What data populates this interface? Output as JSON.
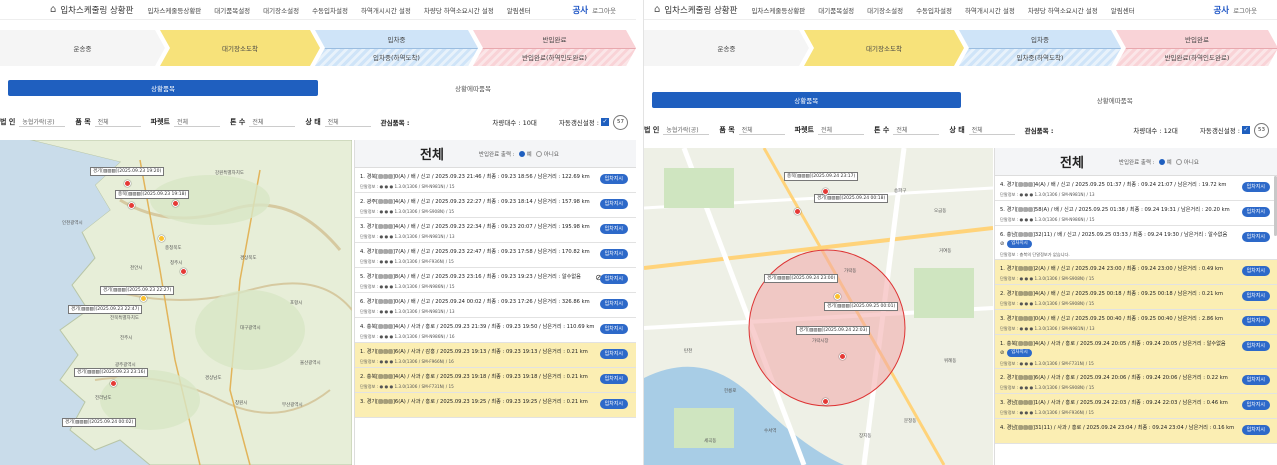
{
  "panels": [
    {
      "nav": {
        "title": "입차스케줄링 상황판",
        "menu": [
          "입차스케줄등상황판",
          "대기품목설정",
          "대기장소설정",
          "수동입차설정",
          "하역개시시간 설정",
          "차량당 하역소요시간 설정",
          "알림센터"
        ],
        "user": "공사",
        "logout": "로그아웃"
      },
      "steps": {
        "moving": "운송중",
        "waiting": "대기장소도착",
        "loading": "입차중",
        "loading_sub": "입차중(하역도착)",
        "unloading": "반입완료",
        "unloading_sub": "반입완료(하역인도완료)"
      },
      "tabs": {
        "active": "상황품목",
        "inactive": "상황에따품목"
      },
      "filters": {
        "corp_label": "법 인",
        "corp_value": "농협가락(공)",
        "item_label": "품 목",
        "item_value": "전체",
        "pallet_label": "파렛트",
        "pallet_value": "전체",
        "ton_label": "톤 수",
        "ton_value": "전체",
        "state_label": "상 태",
        "state_value": "전체",
        "interest": "관심품목 :",
        "count": "차량대수 : 10대",
        "auto": "자동갱신설정 :",
        "timer": "57"
      },
      "map_labels": [
        "경기[▨▨▨](2025.09.23 19:20)",
        "충북[▨▨▨](2025.09.23 19:18)",
        "경기[▨▨▨](2025.09.23 22:27)",
        "경기[▨▨▨](2025.09.23 22:47)",
        "경기[▨▨▨](2025.09.23 23:16)",
        "경기[▨▨▨](2025.09.24 00:02)"
      ],
      "map_places": [
        "강원특별자치도",
        "충청북도",
        "경상북도",
        "전북특별자치도",
        "전라남도",
        "경상남도",
        "대전광역시",
        "대구광역시",
        "광주광역시",
        "부산광역시",
        "인천광역시",
        "천안시",
        "청주시",
        "포항시",
        "울산광역시",
        "전주시",
        "창원시"
      ],
      "list_title": "전체",
      "list_option": "반입완료 출력 :",
      "opt_yes": "예",
      "opt_no": "아니요",
      "btn": "입차지시",
      "rows": [
        {
          "main": "1. 경북[▨▨▨]0(A) / 배 / 신고 / 2025.09.23 21:46 / 최종 : 09.23 18:56 / 남은거리 : 122.69 km",
          "sub": "단말정보 : ● ● ● 1.3.0(1306 / SM-N981N) / 15",
          "y": false,
          "ban": false
        },
        {
          "main": "2. 광주[▨▨▨]4(A) / 배 / 신고 / 2025.09.23 22:27 / 최종 : 09.23 18:14 / 남은거리 : 157.98 km",
          "sub": "단말정보 : ● ● ● 1.3.0(1306 / SM-S908N) / 15",
          "y": false,
          "ban": false
        },
        {
          "main": "3. 경기[▨▨▨]4(A) / 배 / 신고 / 2025.09.23 22:34 / 최종 : 09.23 20:07 / 남은거리 : 195.98 km",
          "sub": "단말정보 : ● ● ● 1.3.0(1306 / SM-N981N) / 13",
          "y": false,
          "ban": false
        },
        {
          "main": "4. 경기[▨▨▨]7(A) / 배 / 신고 / 2025.09.23 22:47 / 최종 : 09.23 17:58 / 남은거리 : 170.82 km",
          "sub": "단말정보 : ● ● ● 1.3.0(1306 / SM-F936N) / 15",
          "y": false,
          "ban": false
        },
        {
          "main": "5. 경기[▨▨▨]8(A) / 배 / 신고 / 2025.09.23 23:16 / 최종 : 09.23 19:23 / 남은거리 : 알수없음",
          "sub": "단말정보 : ● ● ● 1.3.0(1306 / SM-N986N) / 15",
          "y": false,
          "ban": true
        },
        {
          "main": "6. 경기[▨▨▨]0(A) / 배 / 신고 / 2025.09.24 00:02 / 최종 : 09.23 17:26 / 남은거리 : 326.86 km",
          "sub": "단말정보 : ● ● ● 1.3.0(1306 / SM-N981N) / 13",
          "y": false,
          "ban": false
        },
        {
          "main": "4. 충북[▨▨▨]4(A) / 사과 / 홍로 / 2025.09.23 21:39 / 최종 : 09.23 19:50 / 남은거리 : 110.69 km",
          "sub": "단말정보 : ● ● ● 1.3.0(1306 / SM-N986N) / 16",
          "y": false,
          "ban": false
        },
        {
          "main": "1. 경기[▨▨▨]6(A) / 사과 / 감홍 / 2025.09.23 19:13 / 최종 : 09.23 19:13 / 남은거리 : 0.21 km",
          "sub": "단말정보 : ● ● ● 1.3.0(1306 / SM-F966N) / 16",
          "y": true,
          "ban": false
        },
        {
          "main": "2. 충북[▨▨▨]4(A) / 사과 / 홍로 / 2025.09.23 19:18 / 최종 : 09.23 19:18 / 남은거리 : 0.21 km",
          "sub": "단말정보 : ● ● ● 1.3.0(1306 / SM-F731N) / 15",
          "y": true,
          "ban": false
        },
        {
          "main": "3. 경기[▨▨▨]6(A) / 사과 / 홍로 / 2025.09.23 19:25 / 최종 : 09.23 19:25 / 남은거리 : 0.21 km",
          "sub": "",
          "y": true,
          "ban": false
        }
      ]
    },
    {
      "nav": {
        "title": "입차스케줄링 상황판",
        "menu": [
          "입차스케줄등상황판",
          "대기품목설정",
          "대기장소설정",
          "수동입차설정",
          "하역개시시간 설정",
          "차량당 하역소요시간 설정",
          "알림센터"
        ],
        "user": "공사",
        "logout": "로그아웃"
      },
      "steps": {
        "moving": "운송중",
        "waiting": "대기장소도착",
        "loading": "입차중",
        "loading_sub": "입차중(하역도착)",
        "unloading": "반입완료",
        "unloading_sub": "반입완료(하역인도완료)"
      },
      "tabs": {
        "active": "상황품목",
        "inactive": "상황에따품목"
      },
      "filters": {
        "corp_label": "법 인",
        "corp_value": "농협가락(공)",
        "item_label": "품 목",
        "item_value": "전체",
        "pallet_label": "파렛트",
        "pallet_value": "전체",
        "ton_label": "톤 수",
        "ton_value": "전체",
        "state_label": "상 태",
        "state_value": "전체",
        "interest": "관심품목 :",
        "count": "차량대수 : 12대",
        "auto": "자동갱신설정 :",
        "timer": "53"
      },
      "map_labels": [
        "충북[▨▨▨](2025.09.24 23:17)",
        "경기[▨▨▨](2025.09.24 00:18)",
        "경기[▨▨▨](2025.09.25 00:01)",
        "경기[▨▨▨](2025.09.24 23:00)",
        "경기[▨▨▨](2025.09.24 22:03)"
      ],
      "map_places": [
        "가락시장",
        "문정동",
        "송파구",
        "장지동",
        "위례동",
        "거여동",
        "탄천",
        "세곡동",
        "수서역",
        "가락동",
        "오금동",
        "헌릉로"
      ],
      "list_title": "전체",
      "list_option": "반입완료 출력 :",
      "opt_yes": "예",
      "opt_no": "아니요",
      "btn": "입차지시",
      "rows": [
        {
          "main": "4. 경기[▨▨▨]4(A) / 배 / 신고 / 2025.09.25 01:37 / 최종 : 09.24 21:07 / 남은거리 : 19.72 km",
          "sub": "단말정보 : ● ● ● 1.3.0(1306 / SM-N981N) / 13",
          "y": false,
          "ban": false
        },
        {
          "main": "5. 경기[▨▨▨]58(A) / 배 / 신고 / 2025.09.25 01:38 / 최종 : 09.24 19:31 / 남은거리 : 20.20 km",
          "sub": "단말정보 : ● ● ● 1.3.0(1306 / SM-N986N) / 15",
          "y": false,
          "ban": false
        },
        {
          "main": "6. 충남[▨▨▨]32(11) / 배 / 신고 / 2025.09.25 03:33 / 최종 : 09.24 19:30 / 남은거리 : 알수없음",
          "sub": "단말정보 : 충북의 단말정보가 없습니다.",
          "y": false,
          "ban": true,
          "tall": true
        },
        {
          "main": "1. 경기[▨▨▨]2(A) / 배 / 신고 / 2025.09.24 23:00 / 최종 : 09.24 23:00 / 남은거리 : 0.49 km",
          "sub": "단말정보 : ● ● ● 1.3.0(1306 / SM-S908N) / 15",
          "y": true,
          "ban": false
        },
        {
          "main": "2. 경기[▨▨▨]4(A) / 배 / 신고 / 2025.09.25 00:18 / 최종 : 09.25 00:18 / 남은거리 : 0.21 km",
          "sub": "단말정보 : ● ● ● 1.3.0(1306 / SM-S908N) / 15",
          "y": true,
          "ban": false
        },
        {
          "main": "3. 경기[▨▨▨]0(A) / 배 / 신고 / 2025.09.25 00:40 / 최종 : 09.25 00:40 / 남은거리 : 2.86 km",
          "sub": "단말정보 : ● ● ● 1.3.0(1306 / SM-N981N) / 13",
          "y": true,
          "ban": false
        },
        {
          "main": "1. 충북[▨▨▨]4(A) / 사과 / 홍로 / 2025.09.24 20:05 / 최종 : 09.24 20:05 / 남은거리 : 알수없음",
          "sub": "단말정보 : ● ● ● 1.3.0(1306 / SM-F731N) / 15",
          "y": true,
          "ban": true,
          "tall": true
        },
        {
          "main": "2. 경기[▨▨▨]6(A) / 사과 / 홍로 / 2025.09.24 20:06 / 최종 : 09.24 20:06 / 남은거리 : 0.22 km",
          "sub": "단말정보 : ● ● ● 1.3.0(1306 / SM-S908N) / 15",
          "y": true,
          "ban": false
        },
        {
          "main": "3. 경남[▨▨▨]1(A) / 사과 / 홍로 / 2025.09.24 22:03 / 최종 : 09.24 22:03 / 남은거리 : 0.46 km",
          "sub": "단말정보 : ● ● ● 1.3.0(1306 / SM-F936N) / 15",
          "y": true,
          "ban": false
        },
        {
          "main": "4. 경남[▨▨▨]31(11) / 사과 / 홍로 / 2025.09.24 23:04 / 최종 : 09.24 23:04 / 남은거리 : 0.16 km",
          "sub": "",
          "y": true,
          "ban": false
        }
      ]
    }
  ],
  "colors": {
    "accent": "#1f5fbf",
    "waiting": "#f7e27a",
    "loading": "#cfe4f8",
    "unloading": "#f9d3d7",
    "row_highlight": "#fbeeb3",
    "geofence": "#e05a5a"
  },
  "icons": {
    "home": "home-icon",
    "ban": "no-entry-icon",
    "timer": "refresh-timer-icon",
    "pin": "map-pin-icon"
  }
}
